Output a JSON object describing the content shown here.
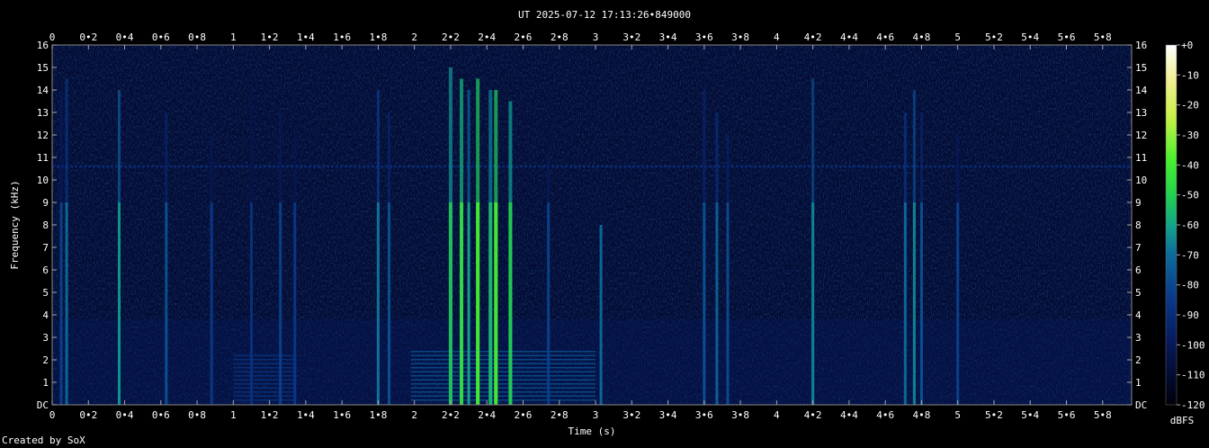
{
  "chart_data": {
    "type": "heatmap",
    "title": "UT 2025-07-12 17:13:26•849000",
    "xlabel": "Time (s)",
    "ylabel": "Frequency (kHz)",
    "xlim": [
      0,
      5.96
    ],
    "ylim": [
      0,
      16
    ],
    "x_ticks": [
      "0",
      "0•2",
      "0•4",
      "0•6",
      "0•8",
      "1",
      "1•2",
      "1•4",
      "1•6",
      "1•8",
      "2",
      "2•2",
      "2•4",
      "2•6",
      "2•8",
      "3",
      "3•2",
      "3•4",
      "3•6",
      "3•8",
      "4",
      "4•2",
      "4•4",
      "4•6",
      "4•8",
      "5",
      "5•2",
      "5•4",
      "5•6",
      "5•8"
    ],
    "y_ticks": [
      "DC",
      "1",
      "2",
      "3",
      "4",
      "5",
      "6",
      "7",
      "8",
      "9",
      "10",
      "11",
      "12",
      "13",
      "14",
      "15",
      "16"
    ],
    "colorbar": {
      "label": "dBFS",
      "ticks": [
        "+0",
        "-10",
        "-20",
        "-30",
        "-40",
        "-50",
        "-60",
        "-70",
        "-80",
        "-90",
        "-100",
        "-110",
        "-120"
      ],
      "range": [
        -120,
        0
      ]
    },
    "tone": {
      "freq_khz": 10.6,
      "level_dbfs": -95
    },
    "bursts": [
      {
        "t": 0.05,
        "level": -88,
        "top_khz": 14
      },
      {
        "t": 0.08,
        "level": -80,
        "top_khz": 14.5
      },
      {
        "t": 0.37,
        "level": -72,
        "top_khz": 14
      },
      {
        "t": 0.63,
        "level": -85,
        "top_khz": 13
      },
      {
        "t": 0.88,
        "level": -90,
        "top_khz": 12
      },
      {
        "t": 1.1,
        "level": -92,
        "top_khz": 14
      },
      {
        "t": 1.26,
        "level": -88,
        "top_khz": 13
      },
      {
        "t": 1.34,
        "level": -90,
        "top_khz": 12
      },
      {
        "t": 1.8,
        "level": -78,
        "top_khz": 14
      },
      {
        "t": 1.86,
        "level": -85,
        "top_khz": 13
      },
      {
        "t": 2.2,
        "level": -62,
        "top_khz": 15
      },
      {
        "t": 2.26,
        "level": -55,
        "top_khz": 14.5
      },
      {
        "t": 2.3,
        "level": -70,
        "top_khz": 14
      },
      {
        "t": 2.35,
        "level": -50,
        "top_khz": 14.5
      },
      {
        "t": 2.42,
        "level": -65,
        "top_khz": 14
      },
      {
        "t": 2.45,
        "level": -50,
        "top_khz": 14
      },
      {
        "t": 2.53,
        "level": -60,
        "top_khz": 13.5
      },
      {
        "t": 2.74,
        "level": -88,
        "top_khz": 11
      },
      {
        "t": 3.03,
        "level": -80,
        "top_khz": 8
      },
      {
        "t": 3.6,
        "level": -85,
        "top_khz": 14
      },
      {
        "t": 3.67,
        "level": -82,
        "top_khz": 13
      },
      {
        "t": 3.73,
        "level": -86,
        "top_khz": 12
      },
      {
        "t": 4.2,
        "level": -75,
        "top_khz": 14.5
      },
      {
        "t": 4.71,
        "level": -80,
        "top_khz": 13
      },
      {
        "t": 4.76,
        "level": -75,
        "top_khz": 14
      },
      {
        "t": 4.8,
        "level": -85,
        "top_khz": 13
      },
      {
        "t": 5.0,
        "level": -88,
        "top_khz": 12
      }
    ],
    "harmonic_blocks": [
      {
        "t_start": 1.0,
        "t_end": 1.35,
        "f_low_khz": 0.2,
        "f_high_khz": 2.3,
        "level": -92
      },
      {
        "t_start": 1.98,
        "t_end": 3.0,
        "f_low_khz": 0.2,
        "f_high_khz": 2.4,
        "level": -85
      }
    ]
  },
  "footer": {
    "credit": "Created by SoX"
  }
}
